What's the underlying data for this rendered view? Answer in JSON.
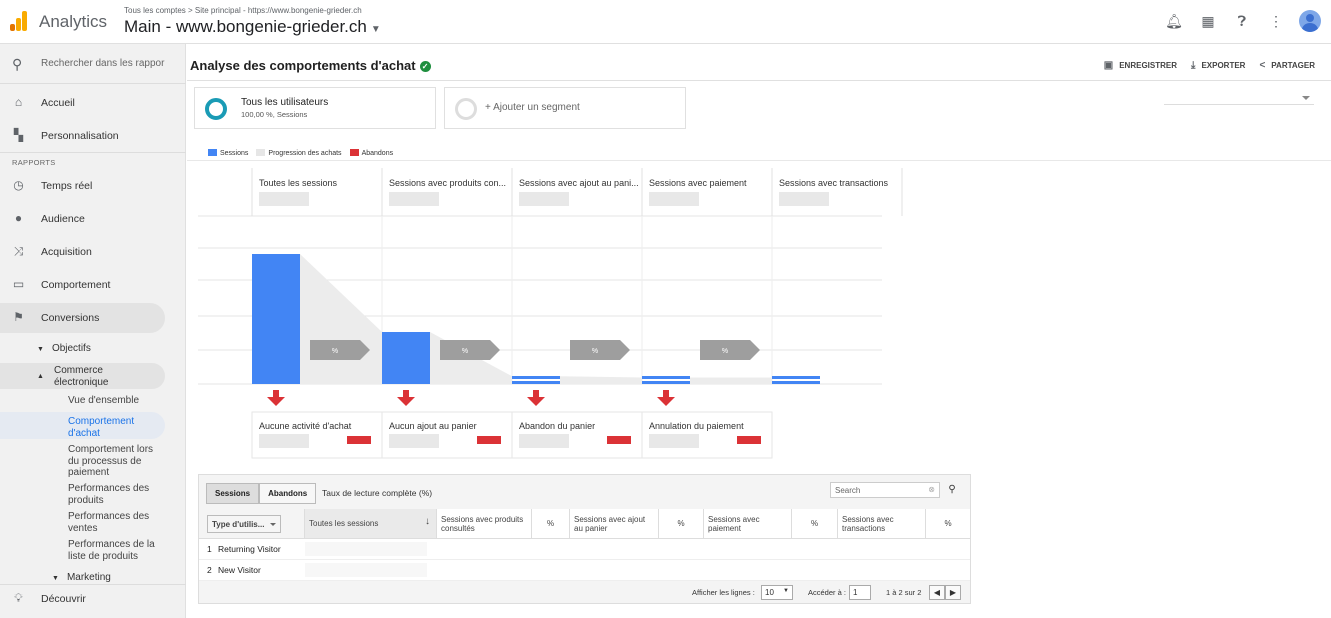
{
  "app": {
    "name": "Analytics",
    "breadcrumb": "Tous les comptes > Site principal - https://www.bongenie-grieder.ch",
    "property": "Main - www.bongenie-grieder.ch"
  },
  "sidebar": {
    "search_placeholder": "Rechercher dans les rappor",
    "home": "Accueil",
    "custom": "Personnalisation",
    "section": "RAPPORTS",
    "realtime": "Temps réel",
    "audience": "Audience",
    "acquisition": "Acquisition",
    "behaviour": "Comportement",
    "conversions": "Conversions",
    "goals": "Objectifs",
    "ecommerce": "Commerce électronique",
    "ecommerce_items": [
      "Vue d'ensemble",
      "Comportement d'achat",
      "Comportement lors du processus de paiement",
      "Performances des produits",
      "Performances des ventes",
      "Performances de la liste de produits"
    ],
    "marketing": "Marketing",
    "discover": "Découvrir"
  },
  "page": {
    "title": "Analyse des comportements d'achat",
    "actions": {
      "save": "ENREGISTRER",
      "export": "EXPORTER",
      "share": "PARTAGER"
    }
  },
  "segments": {
    "all_title": "Tous les utilisateurs",
    "all_sub": "100,00 %, Sessions",
    "add": "+ Ajouter un segment"
  },
  "chart_data": {
    "type": "bar",
    "legend": [
      "Sessions",
      "Progression des achats",
      "Abandons"
    ],
    "colors": {
      "sessions": "#4285f4",
      "progression": "#e6e6e6",
      "abandons": "#db3236"
    },
    "categories": [
      "Toutes les sessions",
      "Sessions avec produits con...",
      "Sessions avec ajout au pani...",
      "Sessions avec paiement",
      "Sessions avec transactions"
    ],
    "values": [
      100,
      40,
      6,
      5,
      5
    ],
    "ylim": [
      0,
      100
    ],
    "arrow_label": "%",
    "abandon_labels": [
      "Aucune activité d'achat",
      "Aucun ajout au panier",
      "Abandon du panier",
      "Annulation du paiement"
    ]
  },
  "table": {
    "tabs": [
      "Sessions",
      "Abandons"
    ],
    "rate_label": "Taux de lecture complète (%)",
    "search_placeholder": "Search",
    "type_select": "Type d'utilis...",
    "headers": [
      "Toutes les sessions",
      "Sessions avec produits consultés",
      "%",
      "Sessions avec ajout au panier",
      "%",
      "Sessions avec paiement",
      "%",
      "Sessions avec transactions",
      "%"
    ],
    "rows": [
      {
        "n": "1",
        "label": "Returning Visitor"
      },
      {
        "n": "2",
        "label": "New Visitor"
      }
    ],
    "show_rows_label": "Afficher les lignes :",
    "show_rows_value": "10",
    "goto_label": "Accéder à :",
    "goto_value": "1",
    "range": "1 à 2 sur 2"
  }
}
